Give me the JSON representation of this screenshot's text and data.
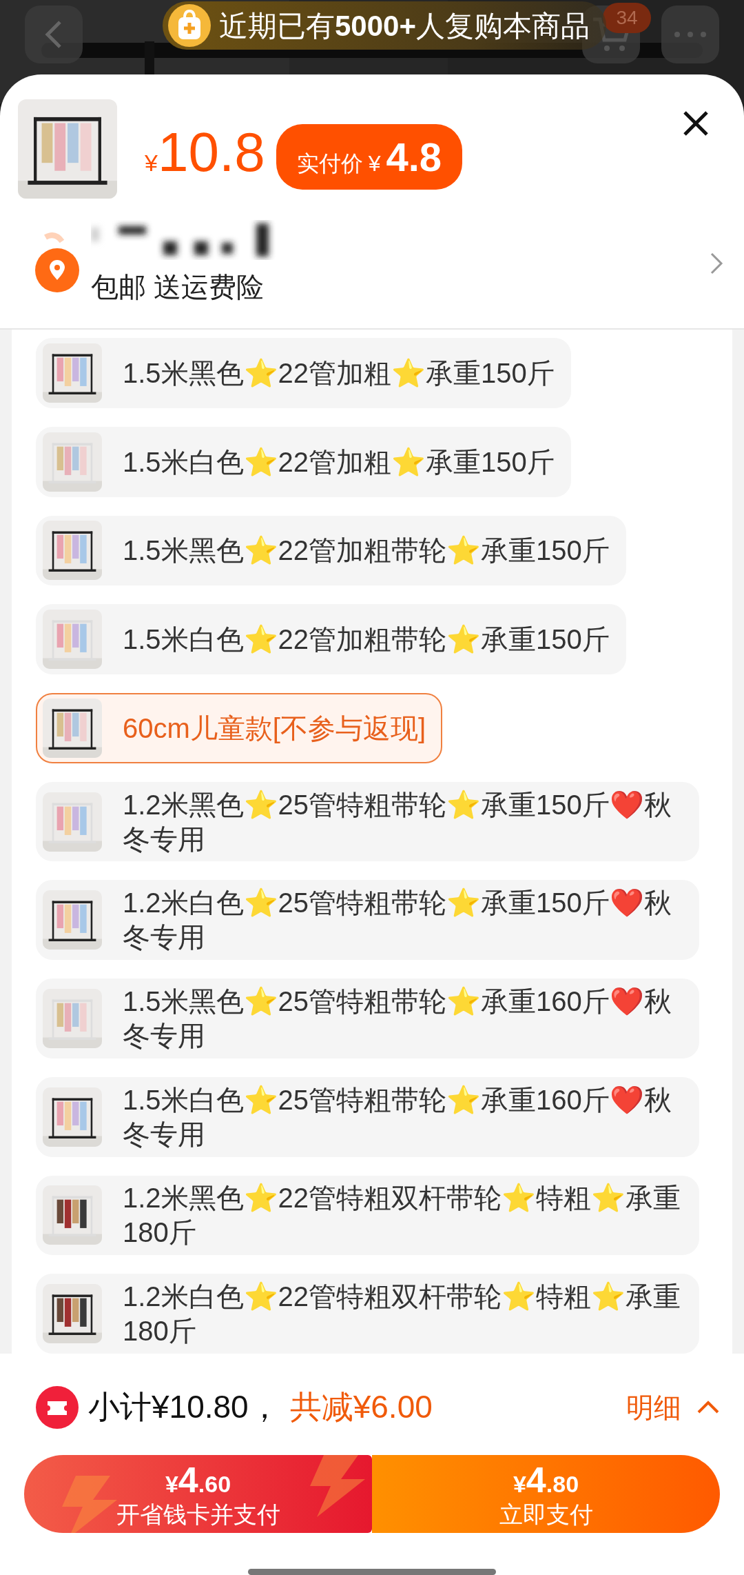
{
  "top_bar": {
    "banner": "近期已有**5000+**人复购本商品",
    "cart_badge": "34"
  },
  "product": {
    "currency": "¥",
    "price": "10.8",
    "pay_label": "实付价",
    "pay_currency": "¥",
    "pay_price": "4.8"
  },
  "address": {
    "shipping": "包邮 送运费险"
  },
  "variants": [
    {
      "label": "1.5米黑色⭐22管加粗⭐承重150斤",
      "selected": false
    },
    {
      "label": "1.5米白色⭐22管加粗⭐承重150斤",
      "selected": false
    },
    {
      "label": "1.5米黑色⭐22管加粗带轮⭐承重150斤",
      "selected": false
    },
    {
      "label": "1.5米白色⭐22管加粗带轮⭐承重150斤",
      "selected": false
    },
    {
      "label": "60cm儿童款[不参与返现]",
      "selected": true
    },
    {
      "label": "1.2米黑色⭐25管特粗带轮⭐承重150斤❤️秋冬专用",
      "selected": false
    },
    {
      "label": "1.2米白色⭐25管特粗带轮⭐承重150斤❤️秋冬专用",
      "selected": false
    },
    {
      "label": "1.5米黑色⭐25管特粗带轮⭐承重160斤❤️秋冬专用",
      "selected": false
    },
    {
      "label": "1.5米白色⭐25管特粗带轮⭐承重160斤❤️秋冬专用",
      "selected": false
    },
    {
      "label": "1.2米黑色⭐22管特粗双杆带轮⭐特粗⭐承重180斤",
      "selected": false
    },
    {
      "label": "1.2米白色⭐22管特粗双杆带轮⭐特粗⭐承重180斤",
      "selected": false
    }
  ],
  "summary": {
    "subtotal": "小计¥10.80，",
    "discount": "共减¥6.00",
    "details": "明细"
  },
  "buttons": [
    {
      "kind": "card",
      "currency": "¥",
      "whole": "4",
      "decimals": ".60",
      "label": "开省钱卡并支付"
    },
    {
      "kind": "pay",
      "currency": "¥",
      "whole": "4",
      "decimals": ".80",
      "label": "立即支付"
    }
  ]
}
